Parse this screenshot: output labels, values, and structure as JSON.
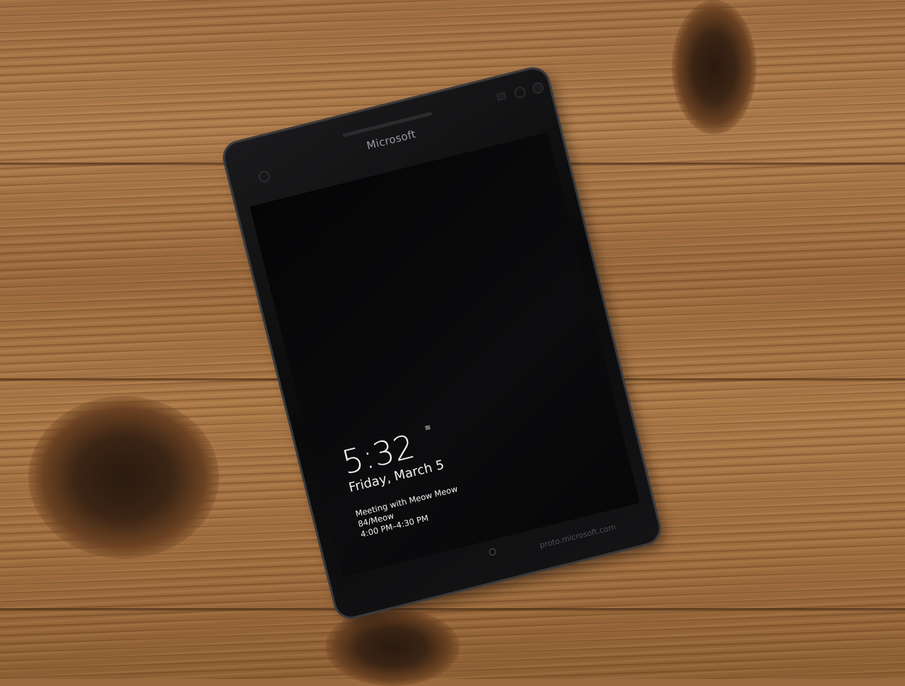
{
  "phone": {
    "brand": "Microsoft",
    "lock_screen": {
      "time": "5:32",
      "date": "Friday, March 5",
      "event_title": "Meeting with Meow Meow",
      "event_location": "84/Meow",
      "event_time": "4:00 PM–4:30 PM",
      "notification_icon": "wifi-icon"
    },
    "watermark": "proto.microsoft.com"
  },
  "colors": {
    "wood": "#a06f42",
    "phone_body": "#0a0a0b",
    "text": "#f2f2f2"
  }
}
